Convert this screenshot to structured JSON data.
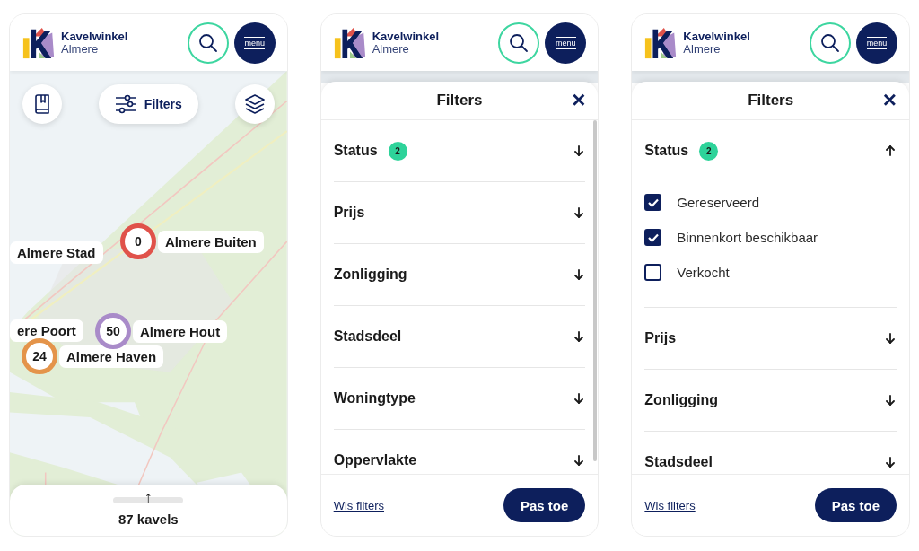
{
  "screens": [
    {
      "kind": "map",
      "header": {
        "brand": "Kavelwinkel",
        "city": "Almere",
        "menu_label": "menu"
      },
      "filters_button": "Filters",
      "clusters": [
        {
          "count": "0",
          "name": "Almere Buiten",
          "color": "#e0524a"
        },
        {
          "name": "Almere Stad"
        },
        {
          "name": "ere Poort"
        },
        {
          "count": "50",
          "name": "Almere Hout",
          "color": "#a98bc9"
        },
        {
          "count": "24",
          "name": "Almere Haven",
          "color": "#e4944a"
        }
      ],
      "sheet": {
        "handle_arrow": "↑",
        "total": "87 kavels"
      }
    },
    {
      "kind": "filters",
      "header": {
        "brand": "Kavelwinkel",
        "city": "Almere",
        "menu_label": "menu"
      },
      "title": "Filters",
      "close": "×",
      "sections": [
        {
          "label": "Status",
          "badge": "2",
          "expanded": false
        },
        {
          "label": "Prijs",
          "expanded": false
        },
        {
          "label": "Zonligging",
          "expanded": false
        },
        {
          "label": "Stadsdeel",
          "expanded": false
        },
        {
          "label": "Woningtype",
          "expanded": false
        },
        {
          "label": "Oppervlakte",
          "expanded": false
        }
      ],
      "clear": "Wis filters",
      "apply": "Pas toe"
    },
    {
      "kind": "filters",
      "header": {
        "brand": "Kavelwinkel",
        "city": "Almere",
        "menu_label": "menu"
      },
      "title": "Filters",
      "close": "×",
      "sections": [
        {
          "label": "Status",
          "badge": "2",
          "expanded": true,
          "options": [
            {
              "label": "Gereserveerd",
              "checked": true
            },
            {
              "label": "Binnenkort beschikbaar",
              "checked": true
            },
            {
              "label": "Verkocht",
              "checked": false
            }
          ]
        },
        {
          "label": "Prijs",
          "expanded": false
        },
        {
          "label": "Zonligging",
          "expanded": false
        },
        {
          "label": "Stadsdeel",
          "expanded": false
        }
      ],
      "clear": "Wis filters",
      "apply": "Pas toe"
    }
  ]
}
